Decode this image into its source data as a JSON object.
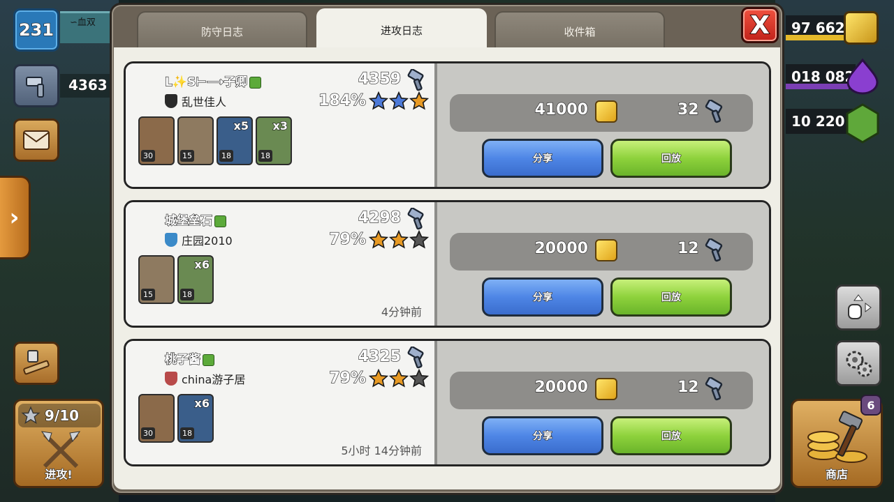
{
  "hud": {
    "level": "231",
    "player_name": "∽血双",
    "trophies": "4363",
    "attack_stars": "9/10",
    "attack_label": "进攻!",
    "shop_label": "商店",
    "shop_badge": "6",
    "gold": "97 662",
    "elixir": "018 082",
    "gems": "10 220",
    "colors": {
      "gold": "#e5b92b",
      "elixir": "#7b3fb4",
      "gems": "#4b8a2a"
    }
  },
  "tabs": [
    {
      "label": "防守日志",
      "active": false
    },
    {
      "label": "进攻日志",
      "active": true
    },
    {
      "label": "收件箱",
      "active": false
    }
  ],
  "close_label": "X",
  "logs": [
    {
      "name": "L✨S⊢⟶子卿",
      "clan": "乱世佳人",
      "clan_color": "#2a2a2a",
      "trophies": "4359",
      "percent": "184%",
      "stars": [
        {
          "color": "#4d7ad8"
        },
        {
          "color": "#4d7ad8"
        },
        {
          "color": "#e89a24"
        }
      ],
      "troops": [
        {
          "level": "30",
          "count": "",
          "kind": "barbarian-cannon",
          "color": "#8b6a4a"
        },
        {
          "level": "15",
          "count": "",
          "kind": "cannon-cart",
          "color": "#8e7a60"
        },
        {
          "level": "18",
          "count": "x5",
          "kind": "pekka",
          "color": "#3a5e8a"
        },
        {
          "level": "18",
          "count": "x3",
          "kind": "baby-dragon",
          "color": "#6a8a52"
        }
      ],
      "time": "",
      "gold": "41000",
      "trophy_gain": "32",
      "share_label": "分享",
      "replay_label": "回放"
    },
    {
      "name": "城堡垒石",
      "clan": "庄园2010",
      "clan_color": "#3b8ac8",
      "trophies": "4298",
      "percent": "79%",
      "stars": [
        {
          "color": "#e89a24"
        },
        {
          "color": "#e89a24"
        },
        {
          "color": "#555555"
        }
      ],
      "troops": [
        {
          "level": "15",
          "count": "",
          "kind": "cannon-cart",
          "color": "#8e7a60"
        },
        {
          "level": "18",
          "count": "x6",
          "kind": "baby-dragon",
          "color": "#6a8a52"
        }
      ],
      "time": "4分钟前",
      "gold": "20000",
      "trophy_gain": "12",
      "share_label": "分享",
      "replay_label": "回放"
    },
    {
      "name": "桃子酱",
      "clan": "china游子居",
      "clan_color": "#b84a4a",
      "trophies": "4325",
      "percent": "79%",
      "stars": [
        {
          "color": "#e89a24"
        },
        {
          "color": "#e89a24"
        },
        {
          "color": "#555555"
        }
      ],
      "troops": [
        {
          "level": "30",
          "count": "",
          "kind": "barbarian-cannon",
          "color": "#8b6a4a"
        },
        {
          "level": "18",
          "count": "x6",
          "kind": "pekka",
          "color": "#3a5e8a"
        }
      ],
      "time": "5小时 14分钟前",
      "gold": "20000",
      "trophy_gain": "12",
      "share_label": "分享",
      "replay_label": "回放"
    }
  ]
}
